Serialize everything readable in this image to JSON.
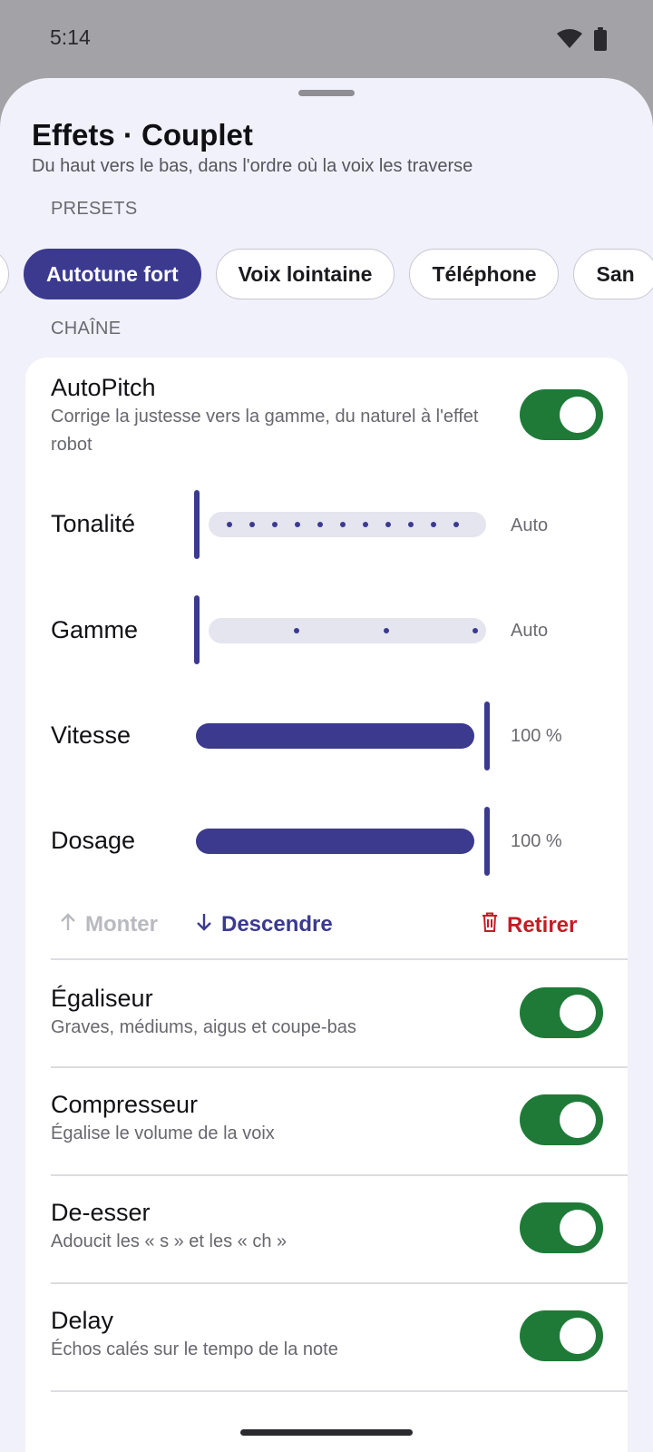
{
  "status_bar": {
    "time": "5:14",
    "wifi_icon": "wifi-icon",
    "battery_icon": "battery-icon"
  },
  "sheet": {
    "title": "Effets · Couplet",
    "subtitle": "Du haut vers le bas, dans l'ordre où la voix les traverse"
  },
  "presets": {
    "label": "PRESETS",
    "chips": [
      {
        "label": "",
        "selected": false
      },
      {
        "label": "Autotune fort",
        "selected": true
      },
      {
        "label": "Voix lointaine",
        "selected": false
      },
      {
        "label": "Téléphone",
        "selected": false
      },
      {
        "label": "San",
        "selected": false
      }
    ]
  },
  "chain": {
    "label": "CHAÎNE",
    "autopitch": {
      "name": "AutoPitch",
      "description": "Corrige la justesse vers la gamme, du naturel à l'effet robot",
      "enabled": true,
      "params": [
        {
          "label": "Tonalité",
          "value": "Auto"
        },
        {
          "label": "Gamme",
          "value": "Auto"
        },
        {
          "label": "Vitesse",
          "value": "100 %",
          "level": 1.0
        },
        {
          "label": "Dosage",
          "value": "100 %",
          "level": 1.0
        }
      ],
      "actions": {
        "move_up": "Monter",
        "move_down": "Descendre",
        "remove": "Retirer"
      }
    },
    "effects": [
      {
        "name": "Égaliseur",
        "description": "Graves, médiums, aigus et coupe-bas",
        "enabled": true
      },
      {
        "name": "Compresseur",
        "description": "Égalise le volume de la voix",
        "enabled": true
      },
      {
        "name": "De-esser",
        "description": "Adoucit les « s » et les « ch »",
        "enabled": true
      },
      {
        "name": "Delay",
        "description": "Échos calés sur le tempo de la note",
        "enabled": true
      }
    ]
  },
  "colors": {
    "accent": "#3b3a8f",
    "toggle_on": "#1f7a38",
    "danger": "#c41c24",
    "sheet_bg": "#f1f1fb"
  }
}
